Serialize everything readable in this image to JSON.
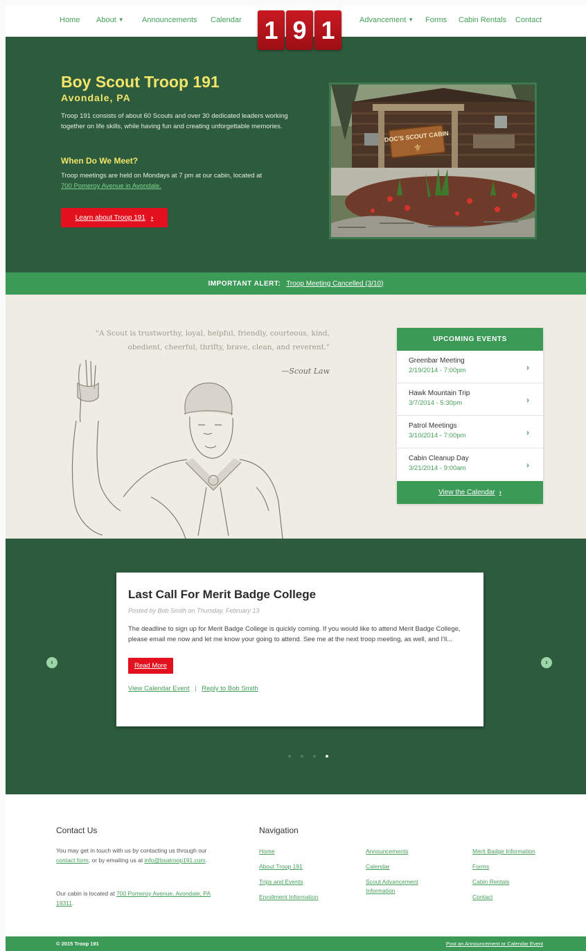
{
  "nav": {
    "left": [
      {
        "label": "Home",
        "dropdown": false
      },
      {
        "label": "About",
        "dropdown": true
      },
      {
        "label": "Announcements",
        "dropdown": false
      },
      {
        "label": "Calendar",
        "dropdown": false
      }
    ],
    "logo": [
      "1",
      "9",
      "1"
    ],
    "right": [
      {
        "label": "Advancement",
        "dropdown": true
      },
      {
        "label": "Forms",
        "dropdown": false
      },
      {
        "label": "Cabin Rentals",
        "dropdown": false
      },
      {
        "label": "Contact",
        "dropdown": false
      }
    ],
    "chevron": "⌄"
  },
  "hero": {
    "title": "Boy Scout Troop 191",
    "subtitle": "Avondale, PA",
    "intro": "Troop 191 consists of about 60 Scouts and over 30 dedicated leaders working together on life skills, while having fun and creating unforgettable memories.",
    "meet_heading": "When Do We Meet?",
    "meet_text": "Troop meetings are held on Mondays at 7 pm at our cabin, located at",
    "meet_link": "700 Pomeroy Avenue in Avondale.",
    "button_label": "Learn about Troop 191",
    "sign_text": "DOC'S SCOUT CABIN"
  },
  "alert": {
    "label": "IMPORTANT ALERT:",
    "link": "Troop Meeting Cancelled (3/10)"
  },
  "quote": {
    "text": "\"A Scout is trustworthy, loyal, helpful, friendly, courteous, kind, obedient, cheerful, thrifty, brave, clean, and reverent.\"",
    "author": "—Scout Law"
  },
  "events": {
    "heading": "UPCOMING EVENTS",
    "items": [
      {
        "name": "Greenbar Meeting",
        "date": "2/19/2014 - 7:00pm"
      },
      {
        "name": "Hawk Mountain Trip",
        "date": "3/7/2014 - 5:30pm"
      },
      {
        "name": "Patrol Meetings",
        "date": "3/10/2014 - 7:00pm"
      },
      {
        "name": "Cabin Cleanup Day",
        "date": "3/21/2014 - 9:00am"
      }
    ],
    "footer_label": "View the Calendar"
  },
  "post": {
    "title": "Last Call For Merit Badge College",
    "byline": "Posted by Bob Smith on Thursday, February 13",
    "body": "The deadline to sign up for Merit Badge College is quickly coming. If you would like to attend Merit Badge College, please email me now and let me know your going to attend. See me at the next troop meeting, as well, and I'll...",
    "read_more": "Read More",
    "link_event": "View Calendar Event",
    "link_separator": "|",
    "link_reply": "Reply to Bob Smith",
    "slides_total": 4,
    "active_slide": 4
  },
  "footer": {
    "contact_heading": "Contact Us",
    "contact_p1_a": "You may get in touch with us by contacting us through our",
    "contact_form_link": "contact form",
    "contact_p1_b": ", or by emailing us at",
    "contact_email": "info@bsatroop191.com",
    "contact_p1_c": ".",
    "contact_p2_a": "Our cabin is located at",
    "contact_address": "700 Pomeroy Avenue, Avondale, PA 19311",
    "contact_p2_b": ".",
    "nav_heading": "Navigation",
    "nav_col1": [
      "Home",
      "About Troop 191",
      "Trips and Events",
      "Enrollment Information"
    ],
    "nav_col2": [
      "Announcements",
      "Calendar",
      "Scout Advancement Information"
    ],
    "nav_col3": [
      "Merit Badge Information",
      "Forms",
      "Cabin Rentals",
      "Contact"
    ]
  },
  "bottom": {
    "copyright": "© 2015 Troop 191",
    "post_link": "Post an Announcement or Calendar Event"
  },
  "colors": {
    "dark_green": "#2d5b3d",
    "accent_green": "#3c9a57",
    "link_green": "#46a05a",
    "red": "#e3111d",
    "yellow": "#f2e56a"
  }
}
